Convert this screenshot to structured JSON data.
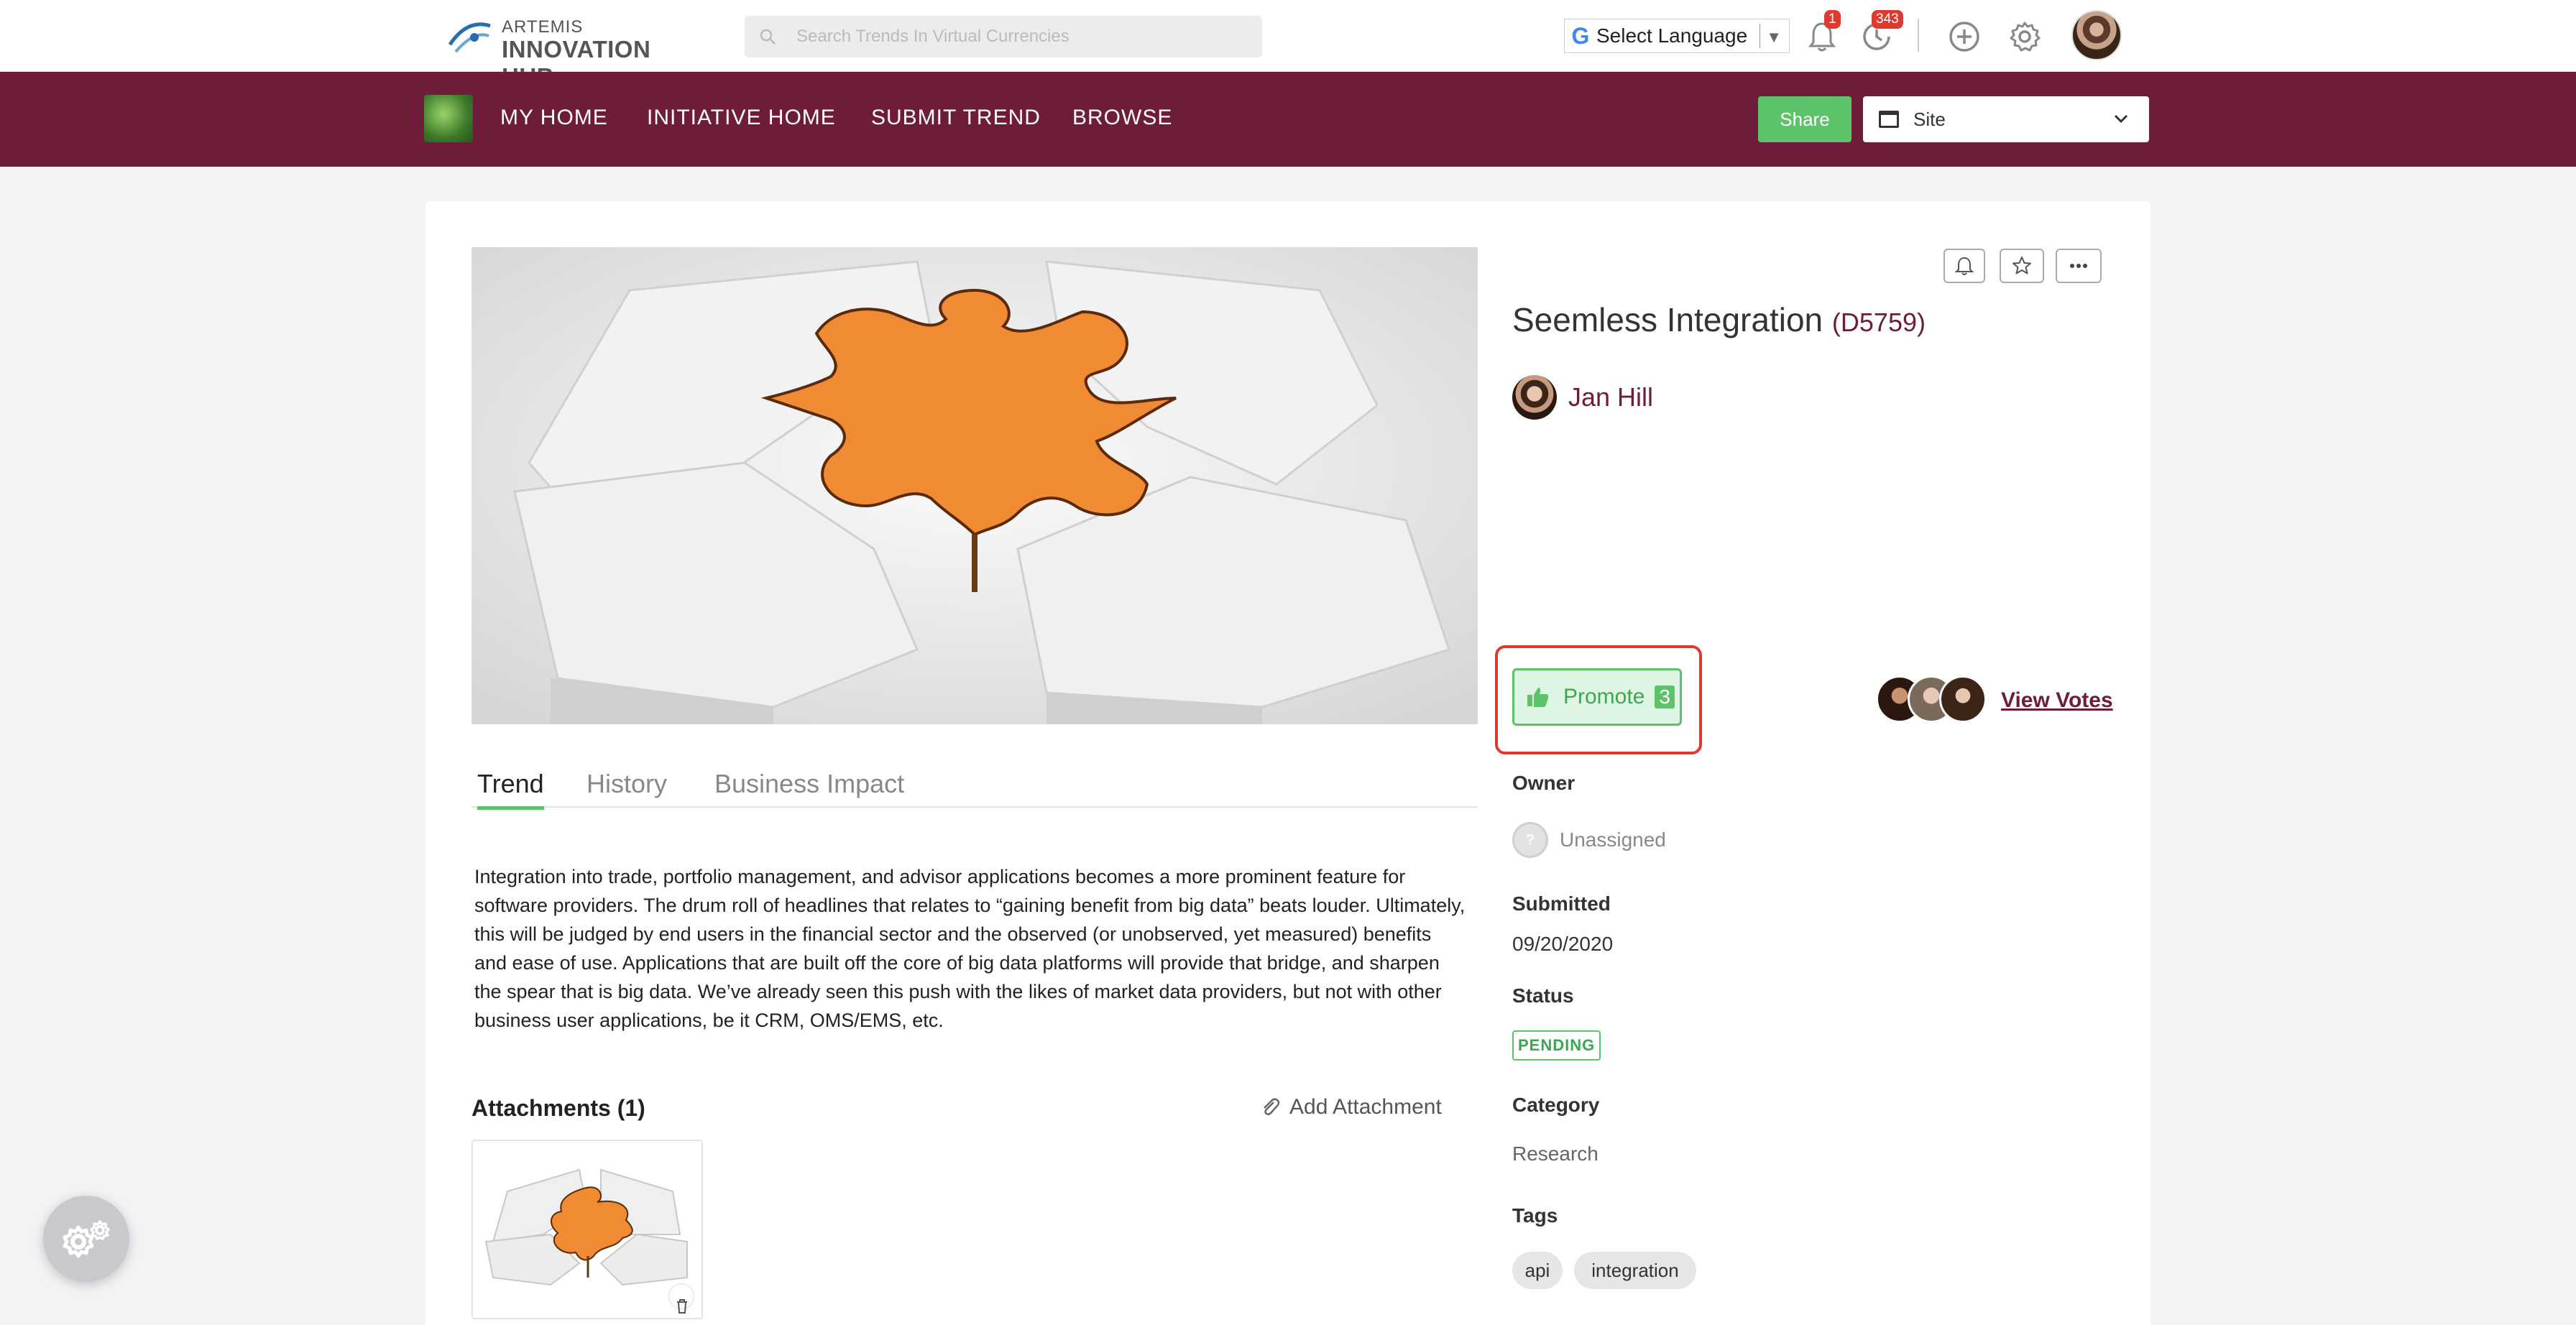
{
  "header": {
    "logo_top": "ARTEMIS",
    "logo_bottom": "INNOVATION HUB",
    "search_placeholder": "Search Trends In Virtual Currencies",
    "language_label": "Select Language",
    "notifications_count": "1",
    "activity_count": "343"
  },
  "nav": {
    "items": [
      "MY HOME",
      "INITIATIVE HOME",
      "SUBMIT TREND",
      "BROWSE"
    ],
    "share_label": "Share",
    "site_select": "Site"
  },
  "trend": {
    "title": "Seemless Integration",
    "code": "(D5759)",
    "author": "Jan Hill",
    "tabs": [
      "Trend",
      "History",
      "Business Impact"
    ],
    "description": "Integration into trade, portfolio management, and advisor applications becomes a more prominent feature for software providers. The drum roll of headlines that relates to “gaining benefit from big data” beats louder. Ultimately, this will be judged by end users in the financial sector and the observed (or unobserved, yet measured) benefits and ease of use. Applications that are built off the core of big data platforms will provide that bridge, and sharpen the spear that is big data. We’ve already seen this push with the likes of market data providers, but not with other business user applications, be it CRM, OMS/EMS, etc.",
    "attachments_title": "Attachments (1)",
    "add_attachment": "Add Attachment",
    "promote_label": "Promote",
    "promote_count": "3",
    "view_votes": "View Votes",
    "owner_label": "Owner",
    "owner_value": "Unassigned",
    "submitted_label": "Submitted",
    "submitted_value": "09/20/2020",
    "status_label": "Status",
    "status_value": "PENDING",
    "category_label": "Category",
    "category_value": "Research",
    "tags_label": "Tags",
    "tags": [
      "api",
      "integration"
    ]
  },
  "colors": {
    "brand": "#6f1b3a",
    "accent_green": "#5cc36b",
    "highlight_red": "#e0392f",
    "puzzle_orange": "#f08a33"
  }
}
